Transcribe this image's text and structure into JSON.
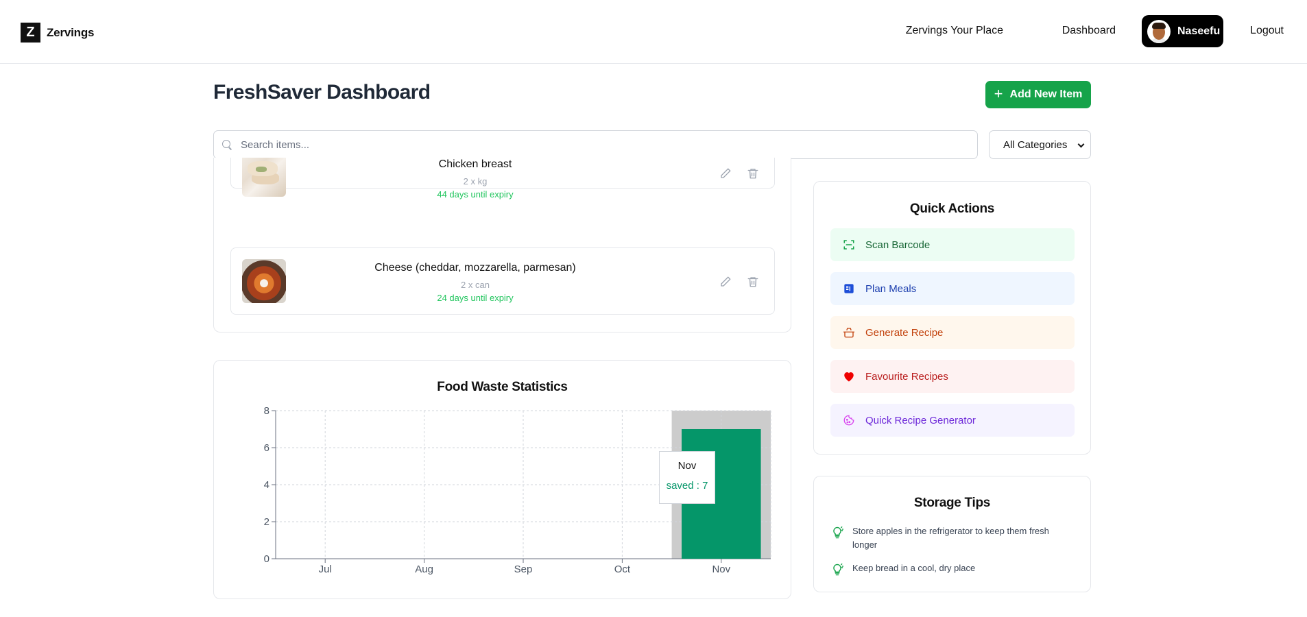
{
  "header": {
    "brand_letter": "Z",
    "brand_name": "Zervings",
    "nav_place": "Zervings Your Place",
    "nav_dashboard": "Dashboard",
    "user_name": "Naseefu",
    "logout": "Logout"
  },
  "page": {
    "title": "FreshSaver Dashboard",
    "add_button": "Add New Item",
    "search_placeholder": "Search items...",
    "category_selected": "All Categories"
  },
  "items": [
    {
      "name": "Chicken breast",
      "qty": "2 x kg",
      "expiry": "44 days until expiry",
      "image": "chicken-breast-photo"
    },
    {
      "name": "Cheese (cheddar, mozzarella, parmesan)",
      "qty": "2 x can",
      "expiry": "24 days until expiry",
      "image": "cheese-dish-photo"
    }
  ],
  "chart_data": {
    "type": "bar",
    "title": "Food Waste Statistics",
    "categories": [
      "Jul",
      "Aug",
      "Sep",
      "Oct",
      "Nov"
    ],
    "series": [
      {
        "name": "saved",
        "values": [
          0,
          0,
          0,
          0,
          7
        ],
        "color": "#059669"
      }
    ],
    "yticks": [
      0,
      2,
      4,
      6,
      8
    ],
    "ylim": [
      0,
      8
    ],
    "grid": true,
    "highlight_category": "Nov",
    "tooltip": {
      "label": "Nov",
      "value_text": "saved : 7"
    }
  },
  "quick_actions": {
    "title": "Quick Actions",
    "buttons": [
      {
        "label": "Scan Barcode",
        "icon": "scan-barcode-icon",
        "bg": "#ecfdf3",
        "color": "#166534"
      },
      {
        "label": "Plan Meals",
        "icon": "calendar-icon",
        "bg": "#eff6ff",
        "color": "#1e40af"
      },
      {
        "label": "Generate Recipe",
        "icon": "cooking-pot-icon",
        "bg": "#fff7ed",
        "color": "#c2410c"
      },
      {
        "label": "Favourite Recipes",
        "icon": "heart-icon",
        "bg": "#fef2f2",
        "color": "#b91c1c"
      },
      {
        "label": "Quick Recipe Generator",
        "icon": "cookie-icon",
        "bg": "#f5f3ff",
        "color": "#6d28d9"
      }
    ]
  },
  "storage_tips": {
    "title": "Storage Tips",
    "tips": [
      "Store apples in the refrigerator to keep them fresh longer",
      "Keep bread in a cool, dry place"
    ]
  },
  "colors": {
    "accent_green": "#16a34a",
    "bar_green": "#059669",
    "expiry_green": "#22c55e"
  }
}
